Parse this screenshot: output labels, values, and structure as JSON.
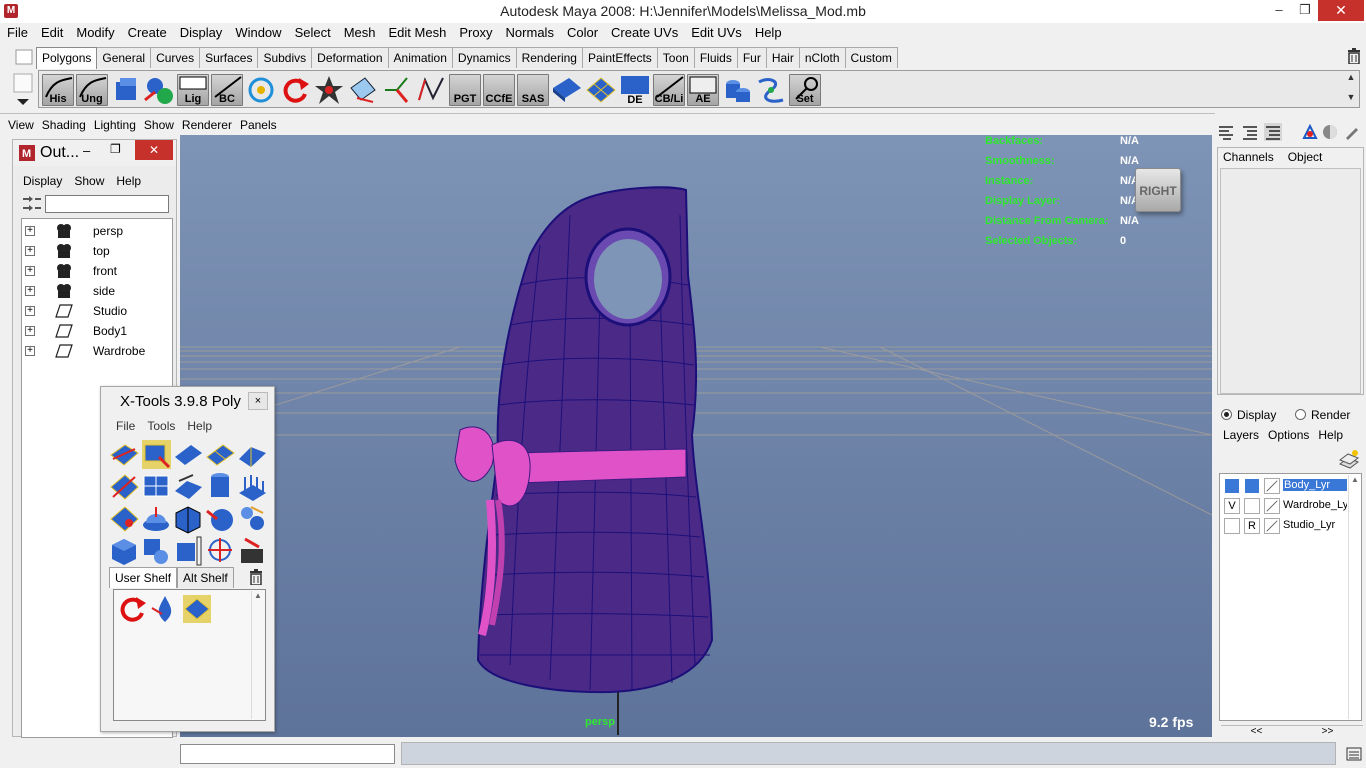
{
  "window": {
    "title": "Autodesk Maya 2008: H:\\Jennifer\\Models\\Melissa_Mod.mb",
    "min": "‒",
    "max": "❐",
    "close": "✕"
  },
  "menu": [
    "File",
    "Edit",
    "Modify",
    "Create",
    "Display",
    "Window",
    "Select",
    "Mesh",
    "Edit Mesh",
    "Proxy",
    "Normals",
    "Color",
    "Create UVs",
    "Edit UVs",
    "Help"
  ],
  "shelf_tabs": [
    "Polygons",
    "General",
    "Curves",
    "Surfaces",
    "Subdivs",
    "Deformation",
    "Animation",
    "Dynamics",
    "Rendering",
    "PaintEffects",
    "Toon",
    "Fluids",
    "Fur",
    "Hair",
    "nCloth",
    "Custom"
  ],
  "shelf_labels": {
    "his": "His",
    "ung": "Ung",
    "lig": "Lig",
    "bc": "BC",
    "pgt": "PGT",
    "ccfe": "CCfE",
    "sas": "SAS",
    "de": "DE",
    "cbl": "CB/Li",
    "ae": "AE",
    "set": "Set"
  },
  "panel_menu": [
    "View",
    "Shading",
    "Lighting",
    "Show",
    "Renderer",
    "Panels"
  ],
  "hud": {
    "rows": [
      {
        "label": "Backfaces:",
        "value": "N/A"
      },
      {
        "label": "Smoothness:",
        "value": "N/A"
      },
      {
        "label": "Instance:",
        "value": "N/A"
      },
      {
        "label": "Display Layer:",
        "value": "N/A"
      },
      {
        "label": "Distance From Camera:",
        "value": "N/A"
      },
      {
        "label": "Selected Objects:",
        "value": "0"
      }
    ],
    "viewcube": "RIGHT",
    "fps": "9.2 fps",
    "camera": "persp"
  },
  "outliner": {
    "title": "Out...",
    "menu": [
      "Display",
      "Show",
      "Help"
    ],
    "filter_value": "",
    "items": [
      {
        "name": "persp",
        "type": "camera"
      },
      {
        "name": "top",
        "type": "camera"
      },
      {
        "name": "front",
        "type": "camera"
      },
      {
        "name": "side",
        "type": "camera"
      },
      {
        "name": "Studio",
        "type": "transform"
      },
      {
        "name": "Body1",
        "type": "transform"
      },
      {
        "name": "Wardrobe",
        "type": "transform"
      }
    ]
  },
  "xtools": {
    "title": "X-Tools 3.9.8 Poly",
    "close": "×",
    "menu": [
      "File",
      "Tools",
      "Help"
    ],
    "tabs": [
      "User Shelf",
      "Alt Shelf"
    ]
  },
  "channel_box": {
    "menu": [
      "Channels",
      "Object"
    ]
  },
  "layer_editor": {
    "mode_display": "Display",
    "mode_render": "Render",
    "menu": [
      "Layers",
      "Options",
      "Help"
    ],
    "layers": [
      {
        "name": "Body_Lyr",
        "v": "",
        "r": "",
        "selected": true
      },
      {
        "name": "Wardrobe_Lyr",
        "v": "V",
        "r": "",
        "selected": false
      },
      {
        "name": "Studio_Lyr",
        "v": "",
        "r": "R",
        "selected": false
      }
    ],
    "prev": "<<",
    "next": ">>"
  },
  "colors": {
    "viewport_bg": "#7088ad",
    "mesh": "#4a2a86",
    "wire": "#1d0f7a",
    "belt": "#e052c8",
    "hud_label": "#2ee82e"
  }
}
